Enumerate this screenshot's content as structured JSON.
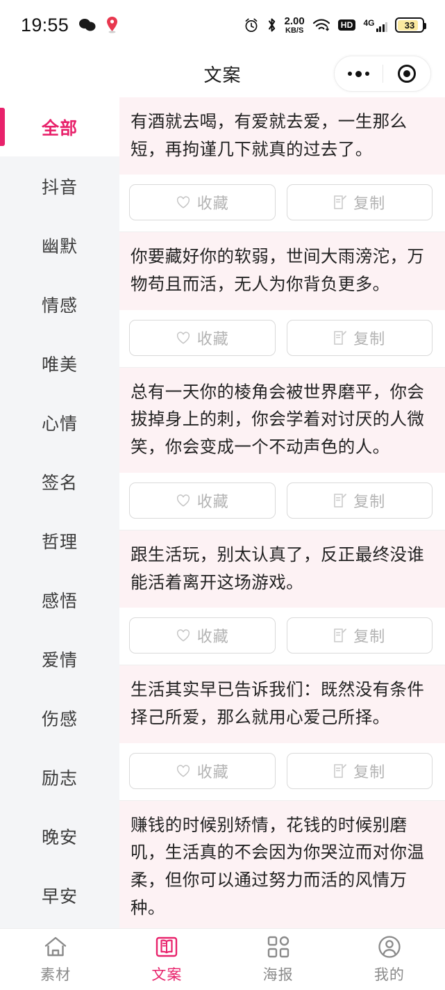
{
  "status_bar": {
    "time": "19:55",
    "left_icons": [
      "wechat-icon",
      "location-pin-icon"
    ],
    "alarm_icon": "alarm-clock-icon",
    "bluetooth_icon": "bluetooth-icon",
    "net_speed_value": "2.00",
    "net_speed_unit": "KB/S",
    "wifi_icon": "wifi-icon",
    "hd_badge": "HD",
    "network_type": "4G",
    "battery_level": "33"
  },
  "header": {
    "title": "文案",
    "capsule": {
      "menu_icon": "ellipsis-icon",
      "close_icon": "target-circle-icon"
    }
  },
  "sidebar": {
    "items": [
      {
        "label": "全部",
        "active": true
      },
      {
        "label": "抖音",
        "active": false
      },
      {
        "label": "幽默",
        "active": false
      },
      {
        "label": "情感",
        "active": false
      },
      {
        "label": "唯美",
        "active": false
      },
      {
        "label": "心情",
        "active": false
      },
      {
        "label": "签名",
        "active": false
      },
      {
        "label": "哲理",
        "active": false
      },
      {
        "label": "感悟",
        "active": false
      },
      {
        "label": "爱情",
        "active": false
      },
      {
        "label": "伤感",
        "active": false
      },
      {
        "label": "励志",
        "active": false
      },
      {
        "label": "晚安",
        "active": false
      },
      {
        "label": "早安",
        "active": false
      }
    ]
  },
  "actions": {
    "favorite_label": "收藏",
    "copy_label": "复制",
    "favorite_icon": "heart-icon",
    "copy_icon": "copy-document-icon"
  },
  "cards": [
    {
      "text": "有酒就去喝，有爱就去爱，一生那么短，再拘谨几下就真的过去了。"
    },
    {
      "text": "你要藏好你的软弱，世间大雨滂沱，万物苟且而活，无人为你背负更多。"
    },
    {
      "text": "总有一天你的棱角会被世界磨平，你会拔掉身上的刺，你会学着对讨厌的人微笑，你会变成一个不动声色的人。"
    },
    {
      "text": "跟生活玩，别太认真了，反正最终没谁能活着离开这场游戏。"
    },
    {
      "text": "生活其实早已告诉我们：既然没有条件择己所爱，那么就用心爱己所择。"
    },
    {
      "text": "赚钱的时候别矫情，花钱的时候别磨叽，生活真的不会因为你哭泣而对你温柔，但你可以通过努力而活的风情万种。"
    }
  ],
  "tabbar": {
    "items": [
      {
        "label": "素材",
        "icon": "home-icon",
        "active": false
      },
      {
        "label": "文案",
        "icon": "book-icon",
        "active": true
      },
      {
        "label": "海报",
        "icon": "grid-icon",
        "active": false
      },
      {
        "label": "我的",
        "icon": "user-circle-icon",
        "active": false
      }
    ]
  },
  "colors": {
    "accent": "#E8226B",
    "card_bg": "#FDF2F4",
    "sidebar_bg": "#F4F5F7",
    "muted_text": "#b3b3b3"
  }
}
